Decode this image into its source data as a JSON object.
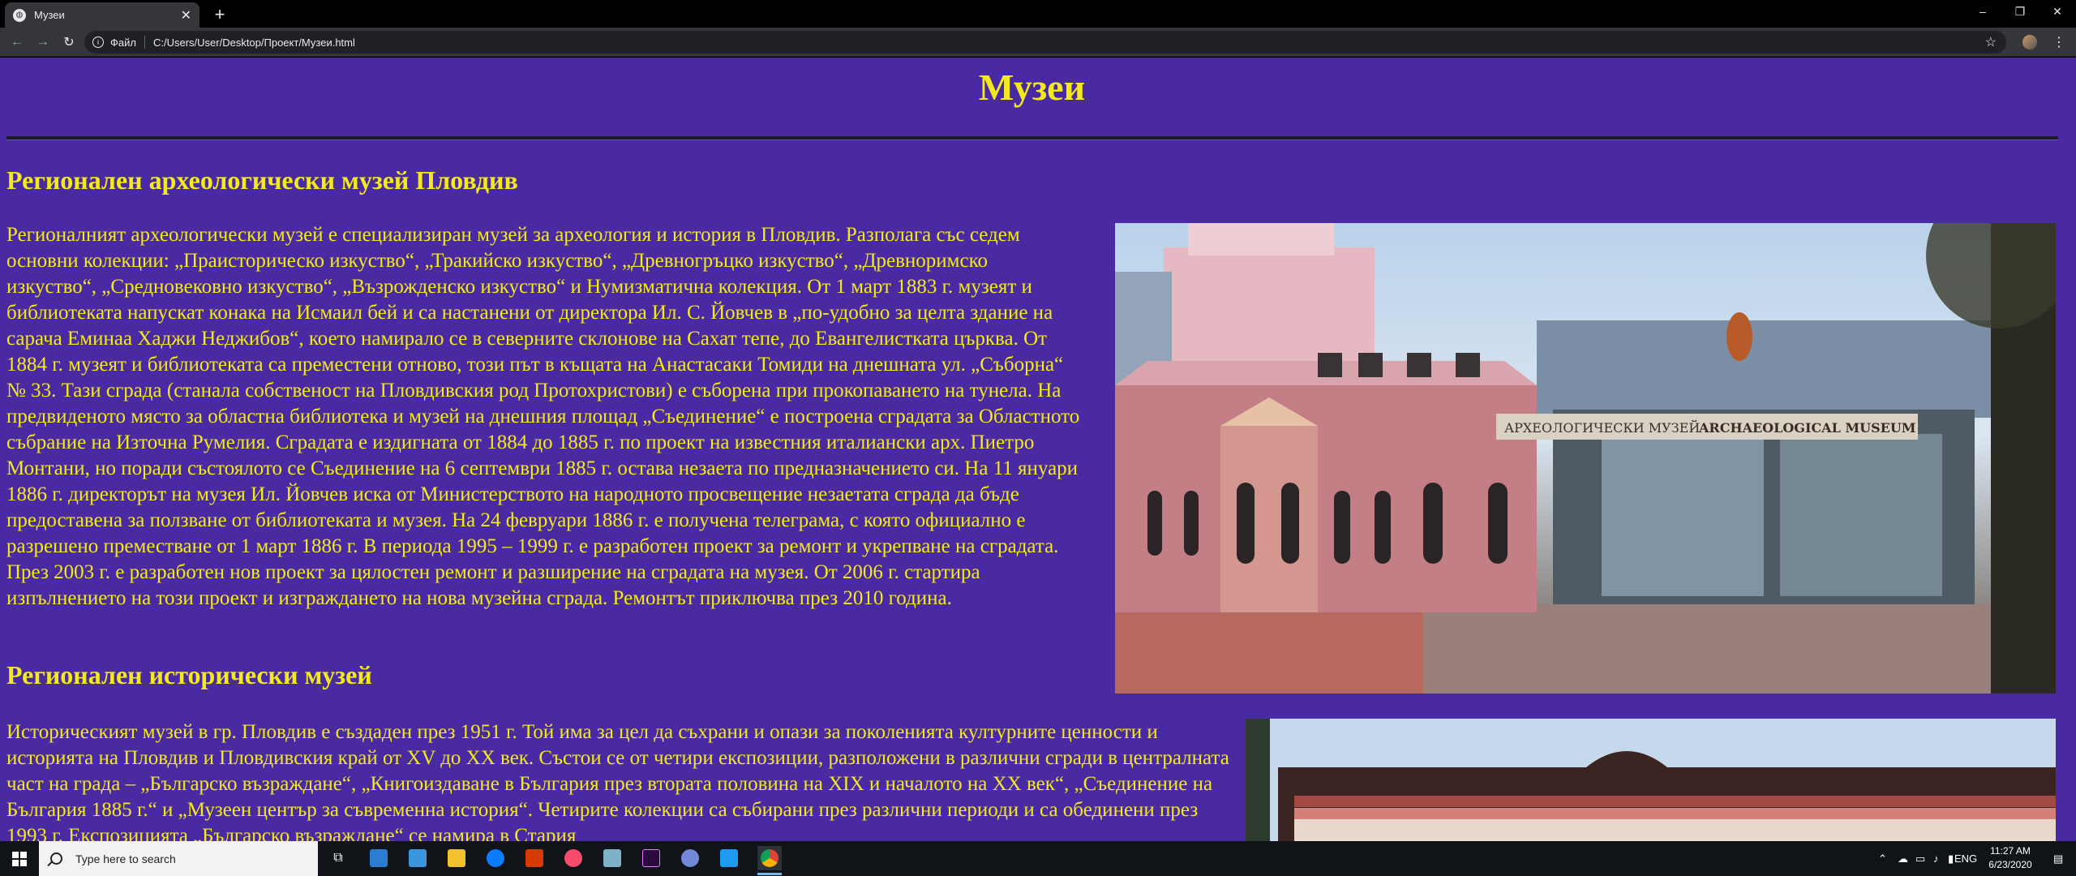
{
  "browser": {
    "tab_title": "Музеи",
    "tab_favicon": "globe-icon",
    "address_prefix": "Файл",
    "address_url": "C:/Users/User/Desktop/Проект/Музеи.html"
  },
  "page": {
    "title": "Музеи",
    "sections": [
      {
        "heading": "Регионален археологически музей Пловдив",
        "text": "Регионалният археологически музей е специализиран музей за археология и история в Пловдив. Разполага със седем основни колекции: „Праисторическо изкуство“, „Тракийско изкуство“, „Древногръцко изкуство“, „Древноримско изкуство“, „Средновековно изкуство“, „Възрожденско изкуство“ и Нумизматична колекция. От 1 март 1883 г. музеят и библиотеката напускат конака на Исмаил бей и са настанени от директора Ил. С. Йовчев в „по-удобно за целта здание на сарача Еминаа Хаджи Неджибов“, което намирало се в северните склонове на Сахат тепе, до Евангелистката църква. От 1884 г. музеят и библиотеката са преместени отново, този път в къщата на Анастасаки Томиди на днешната ул. „Съборна“ № 33. Тази сграда (станала собственост на Пловдивския род Протохристови) е съборена при прокопаването на тунела. На предвиденото място за областна библиотека и музей на днешния площад „Съединение“ е построена сградата за Областното събрание на Източна Румелия. Сградата е издигната от 1884 до 1885 г. по проект на известния италиански арх. Пиетро Монтани, но поради състоялото се Съединение на 6 септември 1885 г. остава незаета по предназначението си. На 11 януари 1886 г. директорът на музея Ил. Йовчев иска от Министерството на народното просвещение незаетата сграда да бъде предоставена за ползване от библиотеката и музея. На 24 февруари 1886 г. е получена телеграма, с която официално е разрешено преместване от 1 март 1886 г. В периода 1995 – 1999 г. е разработен проект за ремонт и укрепване на сградата. През 2003 г. е разработен нов проект за цялостен ремонт и разширение на сградата на музея. От 2006 г. стартира изпълнението на този проект и изграждането на нова музейна сграда. Ремонтът приключва през 2010 година.",
        "image_signs": [
          "АРХЕОЛОГИЧЕСКИ МУЗЕЙ",
          "ARCHAEOLOGICAL MUSEUM"
        ]
      },
      {
        "heading": "Регионален исторически музей",
        "text": "Историческият музей в гр. Пловдив е създаден през 1951 г. Той има за цел да съхрани и опази за поколенията културните ценности и историята на Пловдив и Пловдивския край от XV до XX век. Състои се от четири експозиции, разположени в различни сгради в централната част на града – „Българско възраждане“, „Книгоиздаване в България през втората половина на XIX и началото на XX век“, „Съединение на България 1885 г.“ и „Музеен център за съвременна история“. Четирите колекции са събирани през различни периоди и са обединени през 1993 г. Експозицията „Българско възраждане“ се намира в Стария"
      }
    ]
  },
  "taskbar": {
    "search_placeholder": "Type here to search",
    "language": "ENG",
    "time": "11:27 AM",
    "date": "6/23/2020"
  },
  "colors": {
    "page_background": "#4a2aa2",
    "text": "#f2e91e"
  }
}
